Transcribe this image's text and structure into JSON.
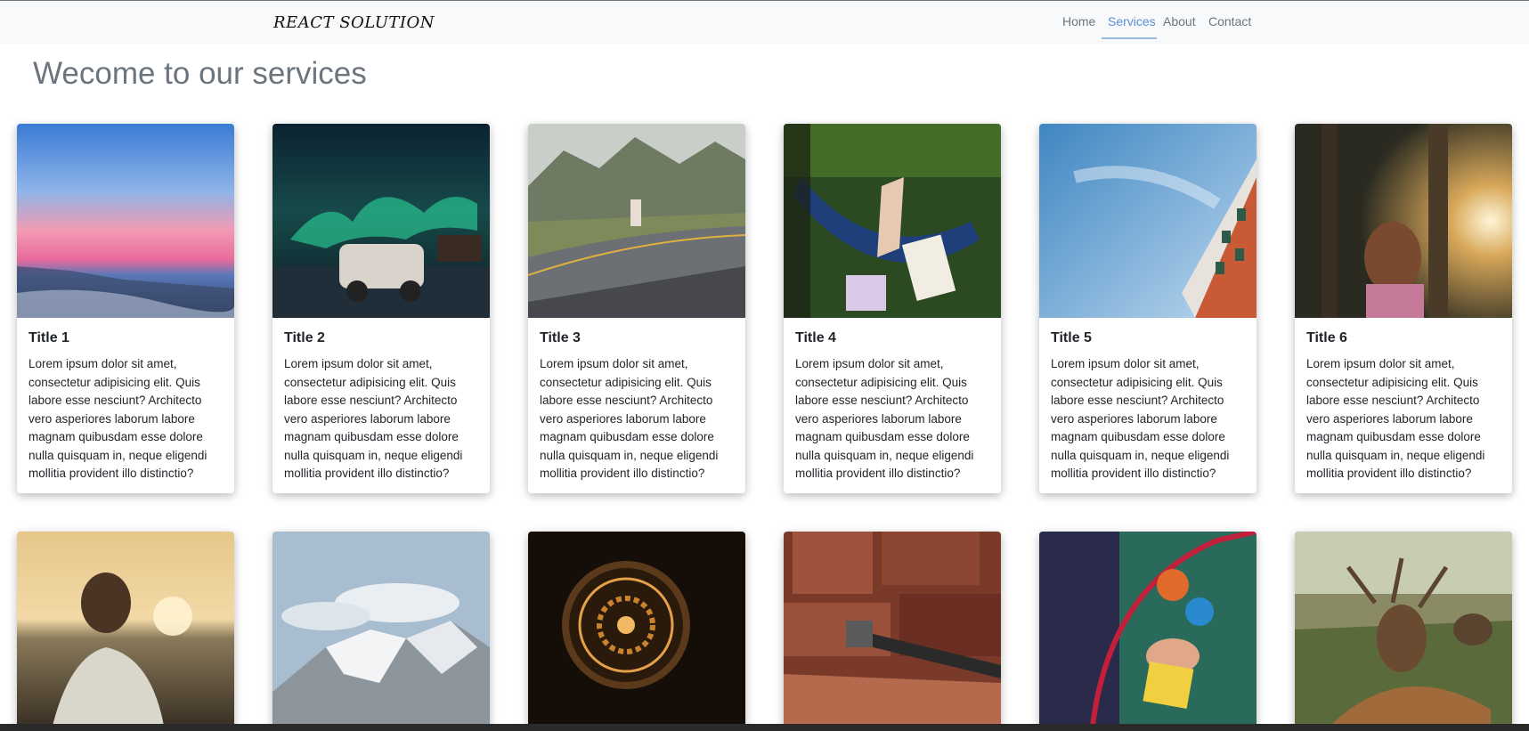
{
  "navbar": {
    "brand": "REACT SOLUTION",
    "links": [
      {
        "label": "Home",
        "active": false
      },
      {
        "label": "Services",
        "active": true
      },
      {
        "label": "About",
        "active": false
      },
      {
        "label": "Contact",
        "active": false
      }
    ]
  },
  "page": {
    "title": "Wecome to our services"
  },
  "cards": [
    {
      "title": "Title 1",
      "text": "Lorem ipsum dolor sit amet, consectetur adipisicing elit. Quis labore esse nesciunt? Architecto vero asperiores laborum labore magnam quibusdam esse dolore nulla quisquam in, neque eligendi mollitia provident illo distinctio?",
      "image": "sunset-beach-photo"
    },
    {
      "title": "Title 2",
      "text": "Lorem ipsum dolor sit amet, consectetur adipisicing elit. Quis labore esse nesciunt? Architecto vero asperiores laborum labore magnam quibusdam esse dolore nulla quisquam in, neque eligendi mollitia provident illo distinctio?",
      "image": "aurora-car-photo"
    },
    {
      "title": "Title 3",
      "text": "Lorem ipsum dolor sit amet, consectetur adipisicing elit. Quis labore esse nesciunt? Architecto vero asperiores laborum labore magnam quibusdam esse dolore nulla quisquam in, neque eligendi mollitia provident illo distinctio?",
      "image": "mountain-road-photo"
    },
    {
      "title": "Title 4",
      "text": "Lorem ipsum dolor sit amet, consectetur adipisicing elit. Quis labore esse nesciunt? Architecto vero asperiores laborum labore magnam quibusdam esse dolore nulla quisquam in, neque eligendi mollitia provident illo distinctio?",
      "image": "hammock-reading-photo"
    },
    {
      "title": "Title 5",
      "text": "Lorem ipsum dolor sit amet, consectetur adipisicing elit. Quis labore esse nesciunt? Architecto vero asperiores laborum labore magnam quibusdam esse dolore nulla quisquam in, neque eligendi mollitia provident illo distinctio?",
      "image": "sky-building-photo"
    },
    {
      "title": "Title 6",
      "text": "Lorem ipsum dolor sit amet, consectetur adipisicing elit. Quis labore esse nesciunt? Architecto vero asperiores laborum labore magnam quibusdam esse dolore nulla quisquam in, neque eligendi mollitia provident illo distinctio?",
      "image": "forest-girl-photo"
    },
    {
      "image": "sunset-man-photo"
    },
    {
      "image": "snowy-mountain-photo"
    },
    {
      "image": "pocket-watch-photo"
    },
    {
      "image": "rocks-hammer-photo"
    },
    {
      "image": "toy-bead-maze-photo"
    },
    {
      "image": "deer-photo"
    }
  ]
}
